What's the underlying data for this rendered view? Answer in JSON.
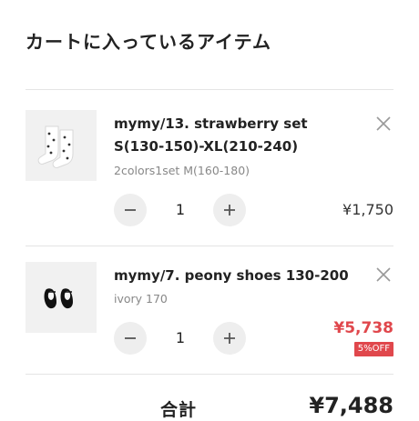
{
  "header": {
    "title": "カートに入っているアイテム"
  },
  "items": [
    {
      "name": "mymy/13. strawberry set S(130-150)-XL(210-240)",
      "variant": "2colors1set M(160-180)",
      "quantity": "1",
      "price": "¥1,750",
      "thumbnail_icon": "socks-image",
      "price_color": "#333333"
    },
    {
      "name": "mymy/7. peony shoes 130-200",
      "variant": "ivory 170",
      "quantity": "1",
      "price": "¥5,738",
      "discount_badge": "5%OFF",
      "thumbnail_icon": "shoes-image",
      "price_color": "#e0474c"
    }
  ],
  "summary": {
    "total_label": "合計",
    "total_value": "¥7,488"
  },
  "colors": {
    "sale": "#e0474c",
    "button_bg": "#eeeeee",
    "divider": "#e4e4e4"
  }
}
